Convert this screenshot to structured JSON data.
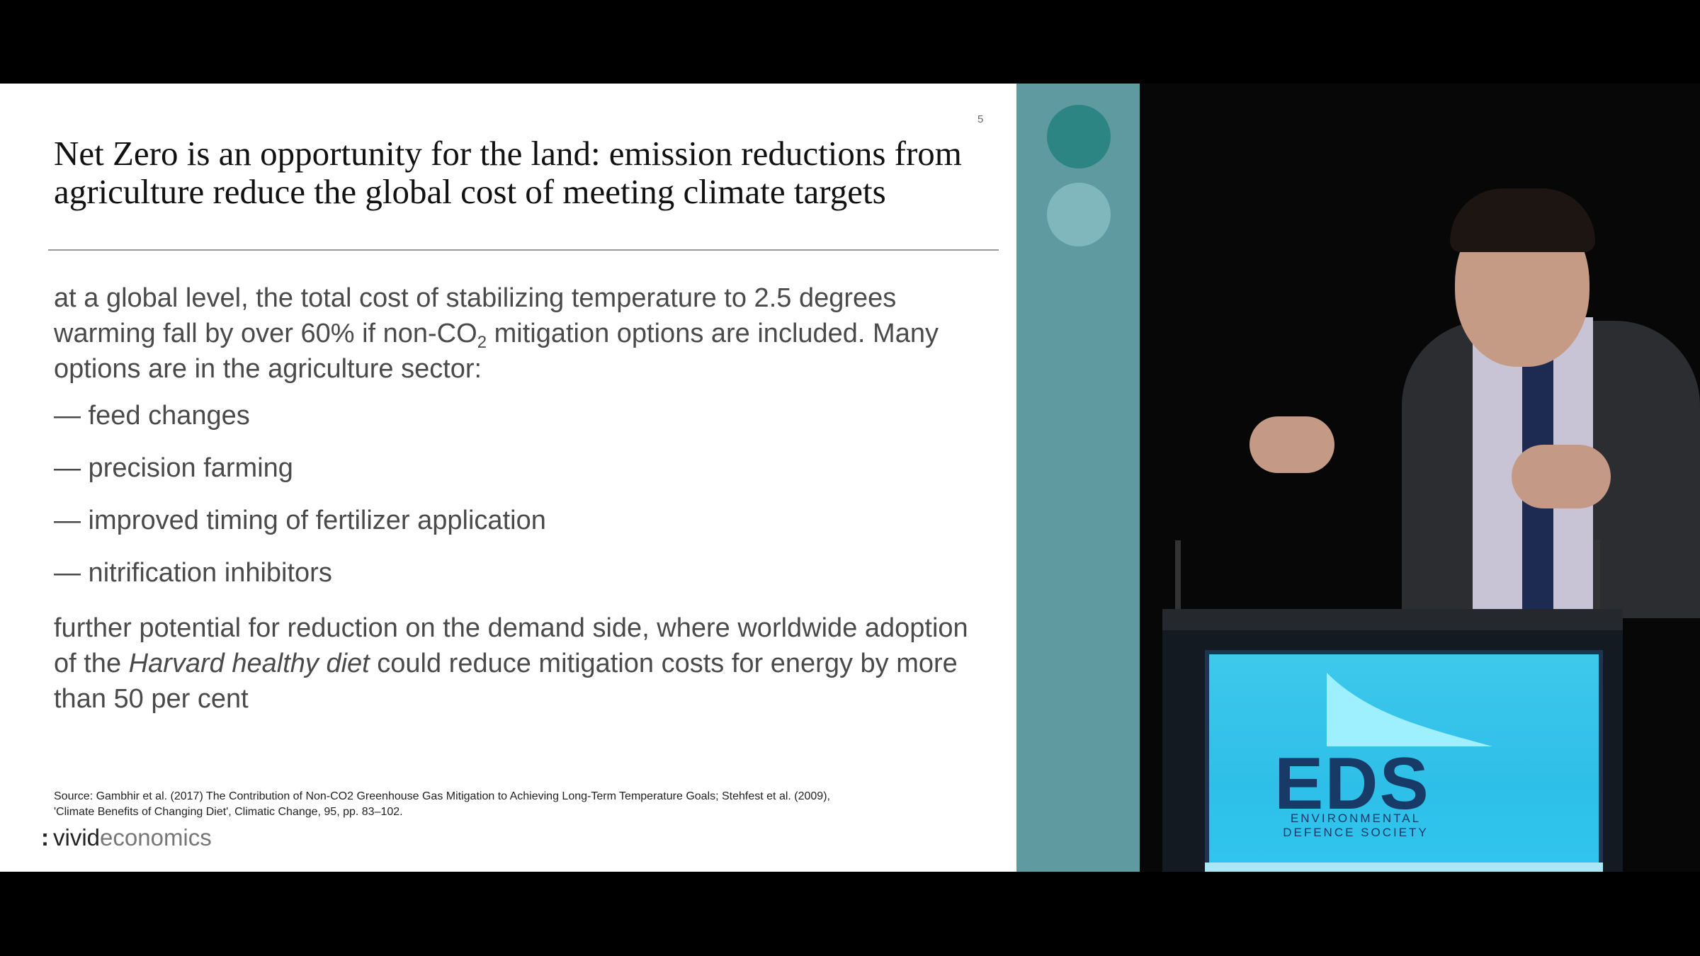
{
  "slide": {
    "number": "5",
    "title": "Net Zero is an opportunity for the land: emission reductions from agriculture reduce the global cost of meeting climate targets",
    "paragraph1_part1": "at a global level, the total cost of stabilizing temperature to 2.5 degrees warming fall by over 60% if non-CO",
    "paragraph1_sub": "2",
    "paragraph1_part2": " mitigation options are included. Many options are in the agriculture sector:",
    "bullets": [
      "— feed changes",
      "— precision farming",
      "— improved timing of fertilizer application",
      "— nitrification inhibitors"
    ],
    "paragraph2_part1": "further potential for reduction on the demand side, where worldwide adoption of the ",
    "paragraph2_emph": "Harvard healthy diet",
    "paragraph2_part2": " could reduce mitigation costs for energy by more than 50 per cent",
    "source_line1": "Source: Gambhir et al. (2017) The Contribution of Non-CO2 Greenhouse Gas Mitigation to Achieving Long-Term Temperature Goals; Stehfest et al. (2009),",
    "source_line2": "'Climate Benefits of Changing Diet', Climatic Change, 95, pp. 83–102.",
    "logo_colon": ":",
    "logo_bold": "vivid",
    "logo_light": "economics"
  },
  "video": {
    "screen_logo": "EDS",
    "screen_sub_line1": "ENVIRONMENTAL",
    "screen_sub_line2": "DEFENCE SOCIETY"
  },
  "colors": {
    "teal_bar": "#5e9aa0",
    "circle_dark": "#2d8583",
    "circle_light": "#7fb7bd",
    "eds_blue": "#173a66"
  }
}
